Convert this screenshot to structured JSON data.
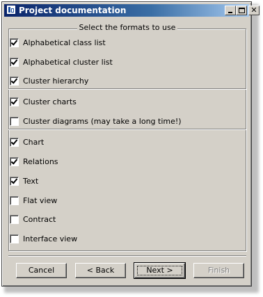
{
  "window": {
    "title": "Project documentation",
    "minimize_glyph": "",
    "maximize_glyph": "",
    "close_glyph": "✕"
  },
  "group": {
    "legend": "Select the formats to use"
  },
  "options": [
    {
      "label": "Alphabetical class list",
      "checked": true
    },
    {
      "label": "Alphabetical cluster list",
      "checked": true
    },
    {
      "label": "Cluster hierarchy",
      "checked": true
    },
    {
      "label": "Cluster charts",
      "checked": true
    },
    {
      "label": "Cluster diagrams (may take a long time!)",
      "checked": false
    },
    {
      "label": "Chart",
      "checked": true
    },
    {
      "label": "Relations",
      "checked": true
    },
    {
      "label": "Text",
      "checked": true
    },
    {
      "label": "Flat view",
      "checked": false
    },
    {
      "label": "Contract",
      "checked": false
    },
    {
      "label": "Interface view",
      "checked": false
    }
  ],
  "buttons": {
    "cancel": "Cancel",
    "back": "< Back",
    "next": "Next >",
    "finish": "Finish"
  },
  "colors": {
    "titlebar_start": "#0a246a",
    "titlebar_end": "#a6caf0",
    "dialog_face": "#d4d0c8"
  }
}
